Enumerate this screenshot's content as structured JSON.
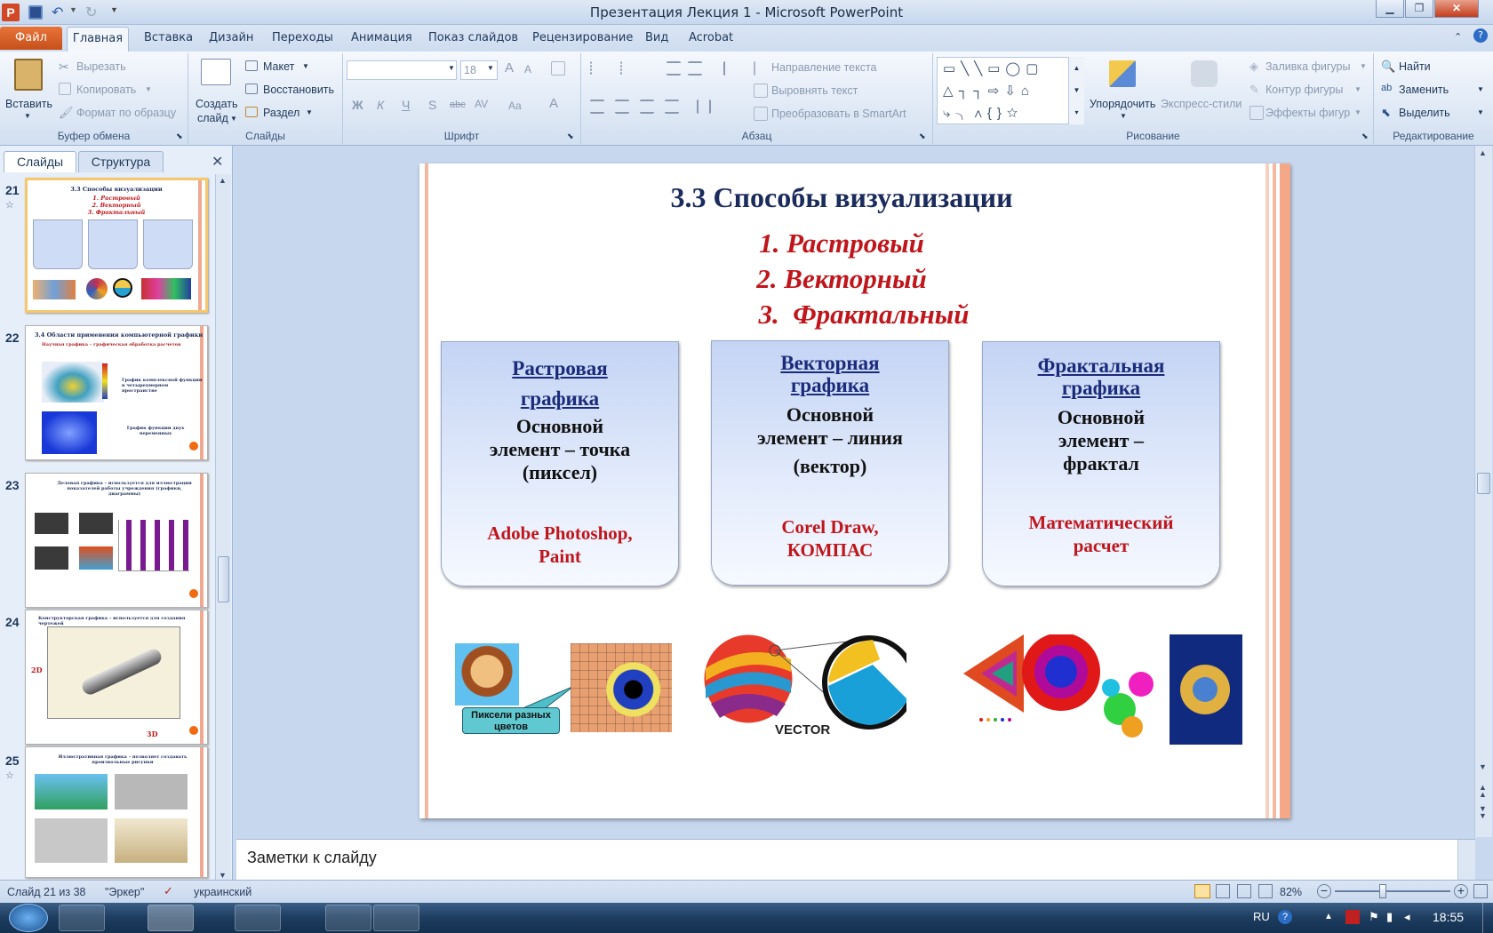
{
  "window": {
    "title": "Презентация Лекция 1 - Microsoft PowerPoint"
  },
  "tabs": [
    "Файл",
    "Главная",
    "Вставка",
    "Дизайн",
    "Переходы",
    "Анимация",
    "Показ слайдов",
    "Рецензирование",
    "Вид",
    "Acrobat"
  ],
  "ribbon": {
    "clipboard": {
      "paste": "Вставить",
      "cut": "Вырезать",
      "copy": "Копировать",
      "format_painter": "Формат по образцу",
      "label": "Буфер обмена"
    },
    "slides": {
      "new_slide_1": "Создать",
      "new_slide_2": "слайд",
      "layout": "Макет",
      "reset": "Восстановить",
      "section": "Раздел",
      "label": "Слайды"
    },
    "font": {
      "size": "18",
      "label": "Шрифт",
      "bold": "Ж",
      "italic": "К",
      "underline": "Ч",
      "shadow": "S",
      "strike": "abc",
      "spacing": "AV",
      "case": "Aa",
      "color": "A",
      "grow": "A",
      "shrink": "A"
    },
    "paragraph": {
      "direction": "Направление текста",
      "align": "Выровнять текст",
      "smartart": "Преобразовать в SmartArt",
      "label": "Абзац"
    },
    "drawing": {
      "arrange": "Упорядочить",
      "styles": "Экспресс-стили",
      "fill": "Заливка фигуры",
      "outline": "Контур фигуры",
      "effects": "Эффекты фигур",
      "label": "Рисование"
    },
    "editing": {
      "find": "Найти",
      "replace": "Заменить",
      "select": "Выделить",
      "label": "Редактирование"
    }
  },
  "pane": {
    "tab_slides": "Слайды",
    "tab_outline": "Структура",
    "close": "✕",
    "thumbs": [
      {
        "num": "21",
        "title": "3.3 Способы визуализации",
        "items": [
          "1. Растровый",
          "2. Векторный",
          "3. Фрактальный"
        ]
      },
      {
        "num": "22",
        "title": "3.4 Области применения компьютерной графики",
        "line1": "Научная графика – графическая обработка расчетов",
        "cap1": "График комплексной функции в четырехмерном пространстве",
        "cap2": "График функции двух переменных"
      },
      {
        "num": "23",
        "title": "Деловая графика – используется для иллюстрации показателей работы учреждения (графики, диаграммы)"
      },
      {
        "num": "24",
        "title": "Конструкторская графика – используется для создания чертежей",
        "l2d": "2D",
        "l3d": "3D"
      },
      {
        "num": "25",
        "title": "Иллюстративная графика – позволяет создавать произвольные рисунки"
      }
    ]
  },
  "slide": {
    "title": "3.3 Способы визуализации",
    "items": [
      "1. Растровый",
      "2. Векторный",
      "3.  Фрактальный"
    ],
    "boxes": [
      {
        "head1": "Растровая",
        "head2": "графика",
        "body": [
          "Основной",
          "элемент – точка",
          "(пиксел)"
        ],
        "tools": [
          "Adobe Photoshop,",
          "Paint"
        ]
      },
      {
        "head1": "Векторная",
        "head2": "графика",
        "body": [
          "Основной",
          "элемент – линия",
          "(вектор)"
        ],
        "tools": [
          "Corel Draw,",
          "КОМПАС"
        ]
      },
      {
        "head1": "Фрактальная",
        "head2": "графика",
        "body": [
          "Основной",
          "элемент –",
          "фрактал"
        ],
        "tools": [
          "Математический",
          "расчет"
        ]
      }
    ],
    "callout": "Пиксели разных цветов",
    "vector_label": "VECTOR"
  },
  "notes": {
    "placeholder": "Заметки к слайду"
  },
  "status": {
    "slide": "Слайд 21 из 38",
    "theme": "\"Эркер\"",
    "lang": "украинский",
    "zoom": "82%"
  },
  "taskbar": {
    "lang": "RU",
    "time": "18:55"
  }
}
